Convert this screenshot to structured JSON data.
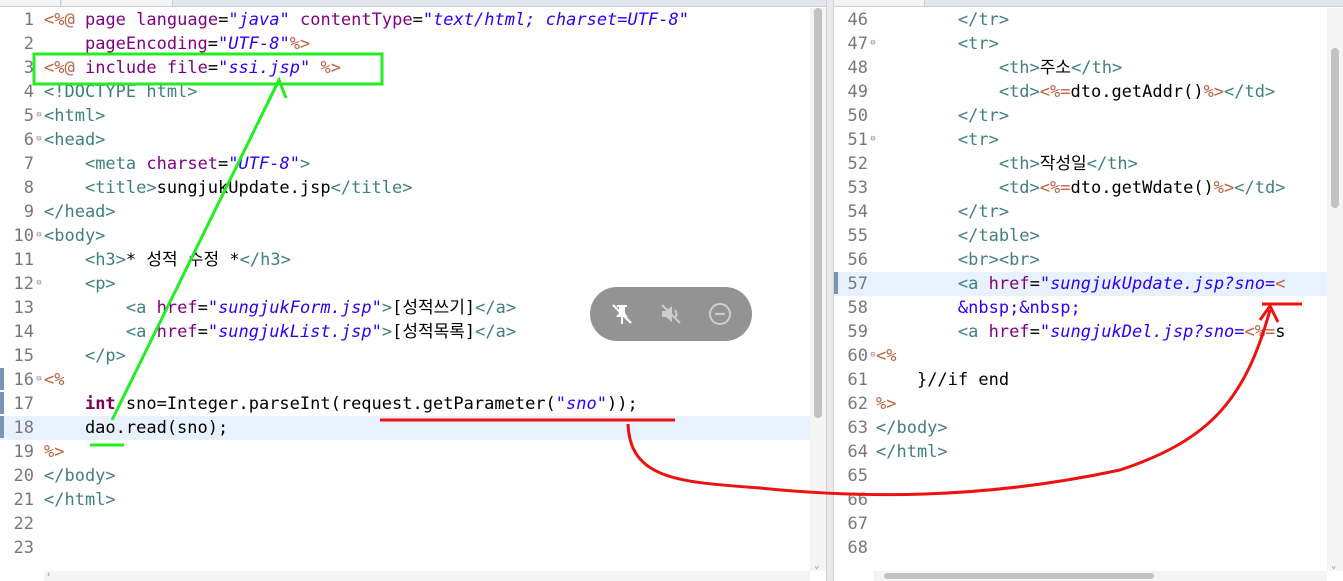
{
  "left_editor": {
    "lines": [
      {
        "n": "1",
        "fold": "",
        "segs": [
          [
            "t-dir",
            "<%@"
          ],
          [
            "t-txt",
            " "
          ],
          [
            "t-attr",
            "page"
          ],
          [
            "t-txt",
            " "
          ],
          [
            "t-attr",
            "language"
          ],
          [
            "t-txt",
            "="
          ],
          [
            "t-str",
            "\"java\""
          ],
          [
            "t-txt",
            " "
          ],
          [
            "t-attr",
            "contentType"
          ],
          [
            "t-txt",
            "="
          ],
          [
            "t-str",
            "\"text/html; charset=UTF-8\""
          ]
        ]
      },
      {
        "n": "2",
        "fold": "",
        "segs": [
          [
            "t-txt",
            "    "
          ],
          [
            "t-attr",
            "pageEncoding"
          ],
          [
            "t-txt",
            "="
          ],
          [
            "t-str",
            "\"UTF-8\""
          ],
          [
            "t-dir",
            "%>"
          ]
        ]
      },
      {
        "n": "3",
        "fold": "",
        "segs": [
          [
            "t-dir",
            "<%@"
          ],
          [
            "t-txt",
            " "
          ],
          [
            "t-attr",
            "include"
          ],
          [
            "t-txt",
            " "
          ],
          [
            "t-attr",
            "file"
          ],
          [
            "t-txt",
            "="
          ],
          [
            "t-str",
            "\"ssi.jsp\""
          ],
          [
            "t-txt",
            " "
          ],
          [
            "t-dir",
            "%>"
          ]
        ]
      },
      {
        "n": "4",
        "fold": "",
        "segs": [
          [
            "t-tag",
            "<!DOCTYPE html>"
          ]
        ]
      },
      {
        "n": "5",
        "fold": "⊖",
        "segs": [
          [
            "t-tag",
            "<html>"
          ]
        ]
      },
      {
        "n": "6",
        "fold": "⊖",
        "segs": [
          [
            "t-tag",
            "<head>"
          ]
        ]
      },
      {
        "n": "7",
        "fold": "",
        "segs": [
          [
            "t-txt",
            "    "
          ],
          [
            "t-tag",
            "<meta"
          ],
          [
            "t-txt",
            " "
          ],
          [
            "t-attr",
            "charset"
          ],
          [
            "t-txt",
            "="
          ],
          [
            "t-str",
            "\"UTF-8\""
          ],
          [
            "t-tag",
            ">"
          ]
        ]
      },
      {
        "n": "8",
        "fold": "",
        "segs": [
          [
            "t-txt",
            "    "
          ],
          [
            "t-tag",
            "<title>"
          ],
          [
            "t-txt",
            "sungjukUpdate.jsp"
          ],
          [
            "t-tag",
            "</title>"
          ]
        ]
      },
      {
        "n": "9",
        "fold": "",
        "segs": [
          [
            "t-tag",
            "</head>"
          ]
        ]
      },
      {
        "n": "10",
        "fold": "⊖",
        "segs": [
          [
            "t-tag",
            "<body>"
          ]
        ]
      },
      {
        "n": "11",
        "fold": "",
        "segs": [
          [
            "t-txt",
            "    "
          ],
          [
            "t-tag",
            "<h3>"
          ],
          [
            "t-txt",
            "* 성적 수정 *"
          ],
          [
            "t-tag",
            "</h3>"
          ]
        ]
      },
      {
        "n": "12",
        "fold": "⊖",
        "segs": [
          [
            "t-txt",
            "    "
          ],
          [
            "t-tag",
            "<p>"
          ]
        ]
      },
      {
        "n": "13",
        "fold": "",
        "segs": [
          [
            "t-txt",
            "        "
          ],
          [
            "t-tag",
            "<a"
          ],
          [
            "t-txt",
            " "
          ],
          [
            "t-attr",
            "href"
          ],
          [
            "t-txt",
            "="
          ],
          [
            "t-str",
            "\"sungjukForm.jsp\""
          ],
          [
            "t-tag",
            ">"
          ],
          [
            "t-txt",
            "[성적쓰기]"
          ],
          [
            "t-tag",
            "</a>"
          ]
        ]
      },
      {
        "n": "14",
        "fold": "",
        "segs": [
          [
            "t-txt",
            "        "
          ],
          [
            "t-tag",
            "<a"
          ],
          [
            "t-txt",
            " "
          ],
          [
            "t-attr",
            "href"
          ],
          [
            "t-txt",
            "="
          ],
          [
            "t-str",
            "\"sungjukList.jsp\""
          ],
          [
            "t-tag",
            ">"
          ],
          [
            "t-txt",
            "[성적목록]"
          ],
          [
            "t-tag",
            "</a>"
          ]
        ]
      },
      {
        "n": "15",
        "fold": "",
        "segs": [
          [
            "t-txt",
            "    "
          ],
          [
            "t-tag",
            "</p>"
          ]
        ]
      },
      {
        "n": "16",
        "fold": "⊖",
        "segs": [
          [
            "t-dir",
            "<%"
          ]
        ]
      },
      {
        "n": "17",
        "fold": "",
        "segs": [
          [
            "t-txt",
            "    "
          ],
          [
            "t-kw",
            "int"
          ],
          [
            "t-txt",
            " sno=Integer.parseInt(request.getParameter("
          ],
          [
            "t-str",
            "\"sno\""
          ],
          [
            "t-txt",
            "));"
          ]
        ]
      },
      {
        "n": "18",
        "fold": "",
        "segs": [
          [
            "t-txt",
            "    dao.read(sno);"
          ]
        ]
      },
      {
        "n": "19",
        "fold": "",
        "segs": [
          [
            "t-dir",
            "%>"
          ]
        ]
      },
      {
        "n": "20",
        "fold": "",
        "segs": [
          [
            "t-tag",
            "</body>"
          ]
        ]
      },
      {
        "n": "21",
        "fold": "",
        "segs": [
          [
            "t-tag",
            "</html>"
          ]
        ]
      },
      {
        "n": "22",
        "fold": "",
        "segs": []
      },
      {
        "n": "23",
        "fold": "",
        "segs": []
      }
    ]
  },
  "right_editor": {
    "lines": [
      {
        "n": "46",
        "fold": "",
        "segs": [
          [
            "t-txt",
            "        "
          ],
          [
            "t-tag",
            "</tr>"
          ]
        ]
      },
      {
        "n": "47",
        "fold": "⊖",
        "segs": [
          [
            "t-txt",
            "        "
          ],
          [
            "t-tag",
            "<tr>"
          ]
        ]
      },
      {
        "n": "48",
        "fold": "",
        "segs": [
          [
            "t-txt",
            "            "
          ],
          [
            "t-tag",
            "<th>"
          ],
          [
            "t-txt",
            "주소"
          ],
          [
            "t-tag",
            "</th>"
          ]
        ]
      },
      {
        "n": "49",
        "fold": "",
        "segs": [
          [
            "t-txt",
            "            "
          ],
          [
            "t-tag",
            "<td>"
          ],
          [
            "t-dir",
            "<%="
          ],
          [
            "t-txt",
            "dto.getAddr()"
          ],
          [
            "t-dir",
            "%>"
          ],
          [
            "t-tag",
            "</td>"
          ]
        ]
      },
      {
        "n": "50",
        "fold": "",
        "segs": [
          [
            "t-txt",
            "        "
          ],
          [
            "t-tag",
            "</tr>"
          ]
        ]
      },
      {
        "n": "51",
        "fold": "⊖",
        "segs": [
          [
            "t-txt",
            "        "
          ],
          [
            "t-tag",
            "<tr>"
          ]
        ]
      },
      {
        "n": "52",
        "fold": "",
        "segs": [
          [
            "t-txt",
            "            "
          ],
          [
            "t-tag",
            "<th>"
          ],
          [
            "t-txt",
            "작성일"
          ],
          [
            "t-tag",
            "</th>"
          ]
        ]
      },
      {
        "n": "53",
        "fold": "",
        "segs": [
          [
            "t-txt",
            "            "
          ],
          [
            "t-tag",
            "<td>"
          ],
          [
            "t-dir",
            "<%="
          ],
          [
            "t-txt",
            "dto.getWdate()"
          ],
          [
            "t-dir",
            "%>"
          ],
          [
            "t-tag",
            "</td>"
          ]
        ]
      },
      {
        "n": "54",
        "fold": "",
        "segs": [
          [
            "t-txt",
            "        "
          ],
          [
            "t-tag",
            "</tr>"
          ]
        ]
      },
      {
        "n": "55",
        "fold": "",
        "segs": [
          [
            "t-txt",
            "        "
          ],
          [
            "t-tag",
            "</table>"
          ]
        ]
      },
      {
        "n": "56",
        "fold": "",
        "segs": [
          [
            "t-txt",
            "        "
          ],
          [
            "t-tag",
            "<br><br>"
          ]
        ]
      },
      {
        "n": "57",
        "fold": "",
        "segs": [
          [
            "t-txt",
            "        "
          ],
          [
            "t-tag",
            "<a"
          ],
          [
            "t-txt",
            " "
          ],
          [
            "t-attr",
            "href"
          ],
          [
            "t-txt",
            "="
          ],
          [
            "t-str",
            "\"sungjukUpdate.jsp?sno="
          ],
          [
            "t-dir",
            "<"
          ]
        ]
      },
      {
        "n": "58",
        "fold": "",
        "segs": [
          [
            "t-txt",
            "        "
          ],
          [
            "t-ent",
            "&nbsp;&nbsp;"
          ]
        ]
      },
      {
        "n": "59",
        "fold": "",
        "segs": [
          [
            "t-txt",
            "        "
          ],
          [
            "t-tag",
            "<a"
          ],
          [
            "t-txt",
            " "
          ],
          [
            "t-attr",
            "href"
          ],
          [
            "t-txt",
            "="
          ],
          [
            "t-str",
            "\"sungjukDel.jsp?sno="
          ],
          [
            "t-dir",
            "<%="
          ],
          [
            "t-txt",
            "s"
          ]
        ]
      },
      {
        "n": "60",
        "fold": "⊖",
        "segs": [
          [
            "t-dir",
            "<%"
          ]
        ]
      },
      {
        "n": "61",
        "fold": "",
        "segs": [
          [
            "t-txt",
            "    }"
          ],
          [
            "t-txt",
            "//if end"
          ]
        ]
      },
      {
        "n": "62",
        "fold": "",
        "segs": [
          [
            "t-dir",
            "%>"
          ]
        ]
      },
      {
        "n": "63",
        "fold": "",
        "segs": [
          [
            "t-tag",
            "</body>"
          ]
        ]
      },
      {
        "n": "64",
        "fold": "",
        "segs": [
          [
            "t-tag",
            "</html>"
          ]
        ]
      },
      {
        "n": "65",
        "fold": "",
        "segs": []
      },
      {
        "n": "66",
        "fold": "",
        "segs": []
      },
      {
        "n": "67",
        "fold": "",
        "segs": []
      },
      {
        "n": "68",
        "fold": "",
        "segs": []
      }
    ]
  },
  "colors": {
    "annotation_green": "#22ee22",
    "annotation_red": "#ee1111",
    "current_line": "#e8f2fe"
  },
  "overlay_toolbar": {
    "icons": [
      "pin-off-icon",
      "mute-icon",
      "minus-circle-icon"
    ]
  }
}
